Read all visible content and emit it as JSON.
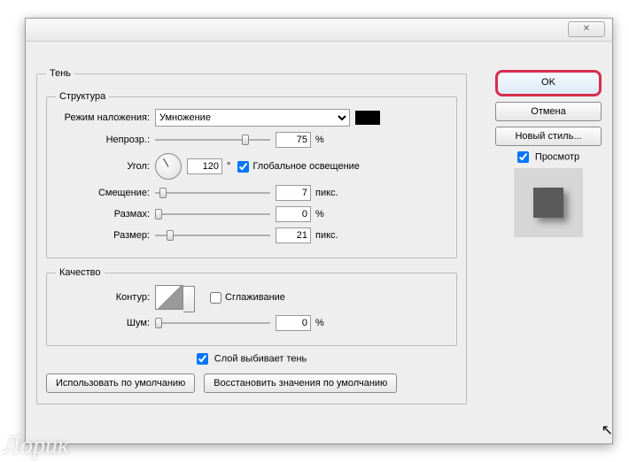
{
  "section_title": "Тень",
  "structure": {
    "legend": "Структура",
    "blend_mode_label": "Режим наложения:",
    "blend_mode_value": "Умножение",
    "opacity_label": "Непрозр.:",
    "opacity_value": "75",
    "opacity_unit": "%",
    "angle_label": "Угол:",
    "angle_value": "120",
    "angle_unit": "°",
    "global_light_label": "Глобальное освещение",
    "global_light_checked": true,
    "offset_label": "Смещение:",
    "offset_value": "7",
    "offset_unit": "пикс.",
    "spread_label": "Размах:",
    "spread_value": "0",
    "spread_unit": "%",
    "size_label": "Размер:",
    "size_value": "21",
    "size_unit": "пикс."
  },
  "quality": {
    "legend": "Качество",
    "contour_label": "Контур:",
    "antialias_label": "Сглаживание",
    "antialias_checked": false,
    "noise_label": "Шум:",
    "noise_value": "0",
    "noise_unit": "%"
  },
  "layer_knockout_label": "Слой выбивает тень",
  "layer_knockout_checked": true,
  "btn_use_default": "Использовать по умолчанию",
  "btn_restore_default": "Восстановить значения по умолчанию",
  "right": {
    "ok": "OK",
    "cancel": "Отмена",
    "new_style": "Новый стиль...",
    "preview_label": "Просмотр",
    "preview_checked": true
  },
  "watermark": "Лорик"
}
